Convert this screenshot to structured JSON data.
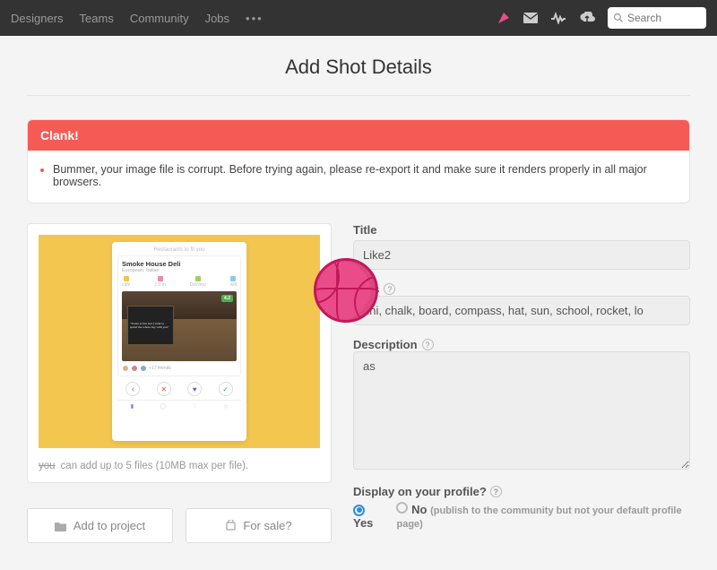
{
  "nav": {
    "items": [
      "Designers",
      "Teams",
      "Community",
      "Jobs"
    ],
    "more": "•••",
    "search_placeholder": "Search"
  },
  "page": {
    "title": "Add Shot Details"
  },
  "alert": {
    "heading": "Clank!",
    "message": "Bummer, your image file is corrupt. Before trying again, please re-export it and make sure it renders properly in all major browsers."
  },
  "upload": {
    "note_prefix": "you",
    "note_rest": " can add up to 5 files (10MB max per file).",
    "add_project": "Add to project",
    "for_sale": "For sale?"
  },
  "mock": {
    "header": "Restaurants to fit you",
    "title": "Smoke House Deli",
    "subtitle": "European, Italian",
    "badge": "4.2",
    "chalk": "\"Today is fun and I want to spend the whole day with you\"",
    "friends": "+17 friends"
  },
  "form": {
    "title_label": "Title",
    "title_value": "Like2",
    "tags_label": "Tags",
    "tags_value": "nni, chalk, board, compass, hat, sun, school, rocket, lo",
    "desc_label": "Description",
    "desc_value": "as",
    "profile_label": "Display on your profile?",
    "yes": "Yes",
    "no": "No",
    "no_note": "(publish to the community but not your default profile page)"
  }
}
